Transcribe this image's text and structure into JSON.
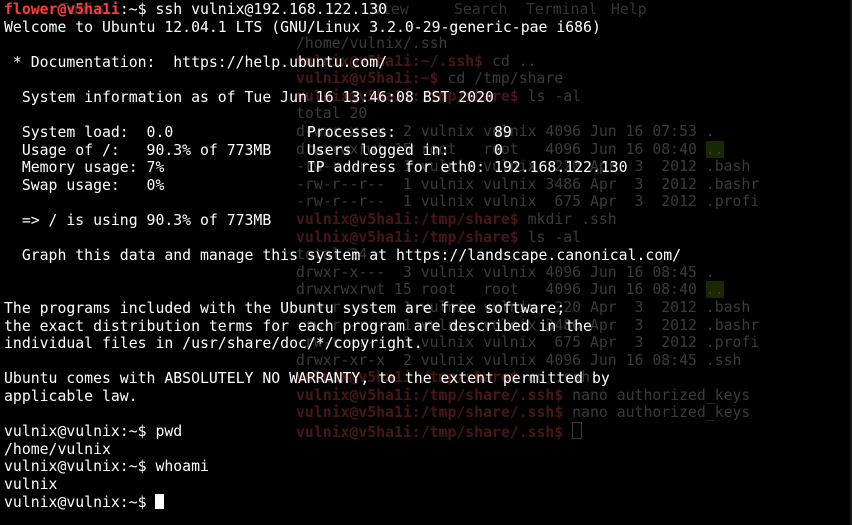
{
  "background_terminal": {
    "menu": [
      "Tools",
      "View",
      "Search",
      "Terminal",
      "Help"
    ],
    "lines": [
      {
        "prompt": "",
        "text": "/home/vulnix/.ssh"
      },
      {
        "prompt": "vulnix@v5ha1i:~/.ssh$",
        "text": " cd .."
      },
      {
        "prompt": "vulnix@v5ha1i:~$",
        "text": " cd /tmp/share"
      },
      {
        "prompt": "vulnix@v5ha1i:/tmp/share$",
        "text": " ls -al"
      },
      {
        "prompt": "",
        "text": "total 20"
      },
      {
        "prompt": "",
        "text": "drwxr-xr-x  2 vulnix vulnix 4096 Jun 16 07:53 ."
      },
      {
        "prompt": "",
        "text": "drwxrwxrwt 15 root   root   4096 Jun 16 08:40 ..",
        "hl": ".."
      },
      {
        "prompt": "",
        "text": "-rw-r--r--  1 vulnix vulnix  220 Apr  3  2012 .bash"
      },
      {
        "prompt": "",
        "text": "-rw-r--r--  1 vulnix vulnix 3486 Apr  3  2012 .bashr"
      },
      {
        "prompt": "",
        "text": "-rw-r--r--  1 vulnix vulnix  675 Apr  3  2012 .profi"
      },
      {
        "prompt": "vulnix@v5ha1i:/tmp/share$",
        "text": " mkdir .ssh"
      },
      {
        "prompt": "vulnix@v5ha1i:/tmp/share$",
        "text": " ls -al"
      },
      {
        "prompt": "",
        "text": "total 24"
      },
      {
        "prompt": "",
        "text": "drwxr-x---  3 vulnix vulnix 4096 Jun 16 08:45 ."
      },
      {
        "prompt": "",
        "text": "drwxrwxrwt 15 root   root   4096 Jun 16 08:40 ..",
        "hl": ".."
      },
      {
        "prompt": "",
        "text": "-rw-r--r--  1 vulnix vulnix  220 Apr  3  2012 .bash"
      },
      {
        "prompt": "",
        "text": "-rw-r--r--  1 vulnix vulnix 3486 Apr  3  2012 .bashr"
      },
      {
        "prompt": "",
        "text": "-rw-r--r--  1 vulnix vulnix  675 Apr  3  2012 .profi"
      },
      {
        "prompt": "",
        "text": "drwxr-xr-x  2 vulnix vulnix 4096 Jun 16 08:45 .ssh"
      },
      {
        "prompt": "vulnix@v5ha1i:/tmp/share$",
        "text": " cd .ssh"
      },
      {
        "prompt": "vulnix@v5ha1i:/tmp/share/.ssh$",
        "text": " nano authorized_keys"
      },
      {
        "prompt": "vulnix@v5ha1i:/tmp/share/.ssh$",
        "text": " nano authorized_keys"
      },
      {
        "prompt": "vulnix@v5ha1i:/tmp/share/.ssh$",
        "text": " "
      }
    ]
  },
  "terminal": {
    "lines": [
      {
        "prompt": "flower@v5ha1i",
        "text": ":~$ ssh vulnix@192.168.122.130"
      },
      {
        "text": "Welcome to Ubuntu 12.04.1 LTS (GNU/Linux 3.2.0-29-generic-pae i686)"
      },
      {
        "text": ""
      },
      {
        "text": " * Documentation:  https://help.ubuntu.com/"
      },
      {
        "text": ""
      },
      {
        "text": "  System information as of Tue Jun 16 13:46:08 BST 2020"
      },
      {
        "text": ""
      },
      {
        "text": "  System load:  0.0               Processes:           89"
      },
      {
        "text": "  Usage of /:   90.3% of 773MB    Users logged in:     0"
      },
      {
        "text": "  Memory usage: 7%                IP address for eth0: 192.168.122.130"
      },
      {
        "text": "  Swap usage:   0%"
      },
      {
        "text": ""
      },
      {
        "text": "  => / is using 90.3% of 773MB"
      },
      {
        "text": ""
      },
      {
        "text": "  Graph this data and manage this system at https://landscape.canonical.com/"
      },
      {
        "text": ""
      },
      {
        "text": ""
      },
      {
        "text": "The programs included with the Ubuntu system are free software;"
      },
      {
        "text": "the exact distribution terms for each program are described in the"
      },
      {
        "text": "individual files in /usr/share/doc/*/copyright."
      },
      {
        "text": ""
      },
      {
        "text": "Ubuntu comes with ABSOLUTELY NO WARRANTY, to the extent permitted by"
      },
      {
        "text": "applicable law."
      },
      {
        "text": ""
      },
      {
        "text": "vulnix@vulnix:~$ pwd"
      },
      {
        "text": "/home/vulnix"
      },
      {
        "text": "vulnix@vulnix:~$ whoami"
      },
      {
        "text": "vulnix"
      },
      {
        "text": "vulnix@vulnix:~$ ",
        "cursor": true
      }
    ]
  }
}
